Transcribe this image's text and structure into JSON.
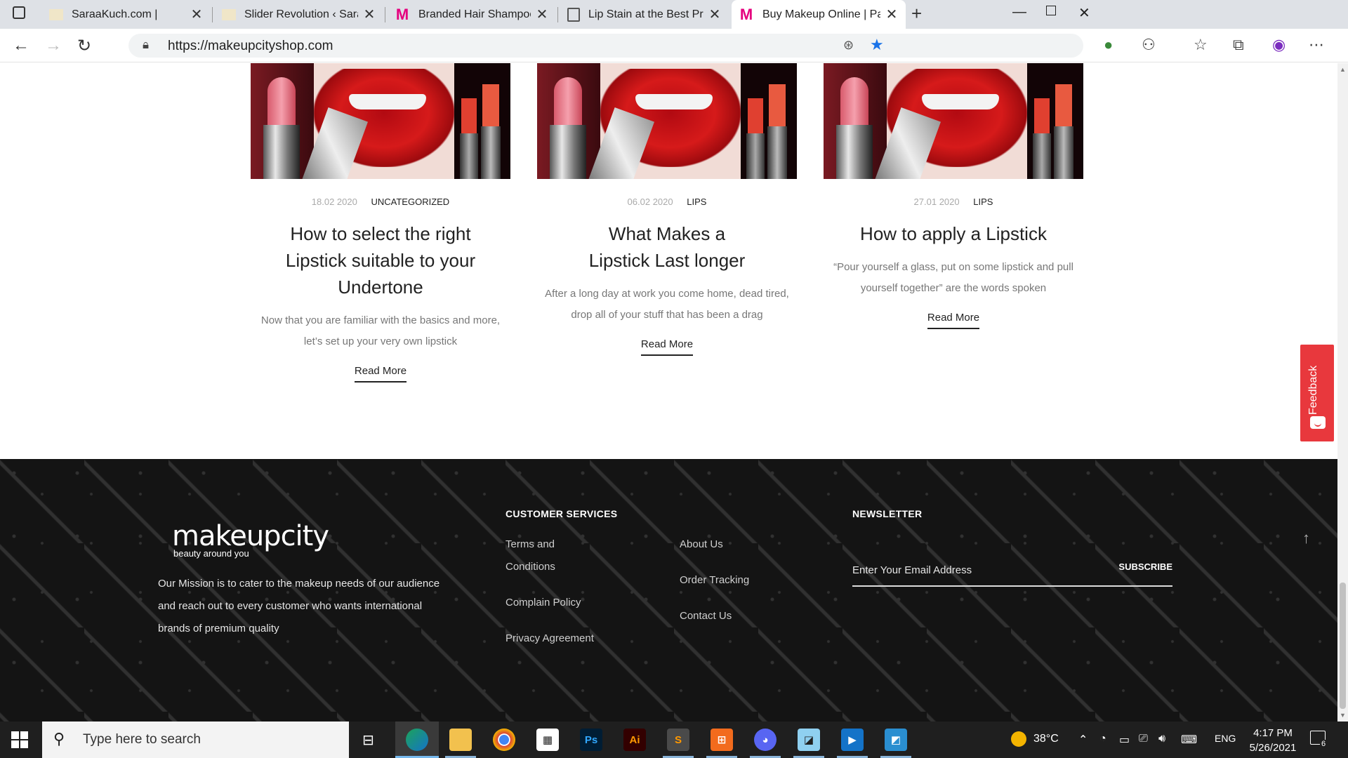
{
  "browser": {
    "tabs": [
      {
        "label": "SaraaKuch.com |",
        "favicon": "site-icon"
      },
      {
        "label": "Slider Revolution ‹ SaraaKuch.com",
        "favicon": "site-icon"
      },
      {
        "label": "Branded Hair Shampoo & Conditioner",
        "favicon": "M"
      },
      {
        "label": "Lip Stain at the Best Price Online",
        "favicon": "bag-icon"
      },
      {
        "label": "Buy Makeup Online | Pakistan's #",
        "favicon": "M"
      }
    ],
    "url": "https://makeupcityshop.com"
  },
  "posts": [
    {
      "date": "18.02 2020",
      "category": "UNCATEGORIZED",
      "title": "How to select the right Lipstick suitable to your Undertone",
      "excerpt": "Now that you are familiar with the basics and more, let’s set up your very own lipstick",
      "read_more": "Read More"
    },
    {
      "date": "06.02 2020",
      "category": "LIPS",
      "title": "What Makes a Lipstick Last longer",
      "excerpt": "After a long day at work you come home, dead tired, drop all of your stuff that has been a drag",
      "read_more": "Read More"
    },
    {
      "date": "27.01 2020",
      "category": "LIPS",
      "title": "How to apply a Lipstick",
      "excerpt": "“Pour yourself a glass, put on some lipstick and pull yourself together” are the words spoken",
      "read_more": "Read More"
    }
  ],
  "feedback": {
    "label": "Feedback"
  },
  "footer": {
    "logo": {
      "main": "makeupcity",
      "sub": "beauty around you"
    },
    "mission": "Our Mission is to cater to the makeup needs of our audience and reach out to every customer who wants international brands of premium quality",
    "customer_services": {
      "heading": "CUSTOMER SERVICES",
      "col1": [
        "Terms and Conditions",
        "Complain Policy",
        "Privacy Agreement"
      ],
      "col2": [
        "About Us",
        "Order Tracking",
        "Contact Us"
      ]
    },
    "newsletter": {
      "heading": "NEWSLETTER",
      "placeholder": "Enter Your Email Address",
      "subscribe": "SUBSCRIBE"
    }
  },
  "taskbar": {
    "search_placeholder": "Type here to search",
    "weather": "38°C",
    "language": "ENG",
    "time": "4:17 PM",
    "date": "5/26/2021",
    "notifications": "6",
    "apps": [
      "Ps",
      "Ai"
    ]
  },
  "colors": {
    "accent_pink": "#e5007e",
    "feedback_red": "#e8383d",
    "footer_bg": "#141414",
    "edge_blue": "#1a73e8"
  }
}
